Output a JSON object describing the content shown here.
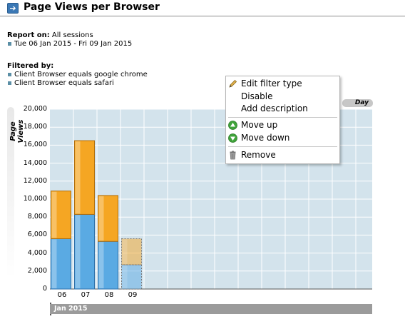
{
  "header": {
    "title": "Page Views per Browser",
    "collapse_icon": "arrow-right-icon"
  },
  "report": {
    "label": "Report on:",
    "value": "All sessions",
    "date_range": "Tue 06 Jan 2015 - Fri 09 Jan 2015"
  },
  "filters": {
    "label": "Filtered by:",
    "items": [
      "Client Browser equals google chrome",
      "Client Browser equals safari"
    ]
  },
  "context_menu": {
    "items": [
      {
        "label": "Edit filter type",
        "icon": "pencil-icon"
      },
      {
        "label": "Disable",
        "icon": ""
      },
      {
        "label": "Add description",
        "icon": ""
      },
      {
        "label": "Move up",
        "icon": "arrow-up-circle-icon"
      },
      {
        "label": "Move down",
        "icon": "arrow-down-circle-icon"
      },
      {
        "label": "Remove",
        "icon": "trash-icon"
      }
    ]
  },
  "chart_data": {
    "type": "bar",
    "stacked": true,
    "title": "",
    "ylabel": "Page Views",
    "xlabel": "",
    "ylim": [
      0,
      20000
    ],
    "yticks": [
      "0",
      "2,000",
      "4,000",
      "6,000",
      "8,000",
      "10,000",
      "12,000",
      "14,000",
      "16,000",
      "18,000",
      "20,000"
    ],
    "categories": [
      "06",
      "07",
      "08",
      "09"
    ],
    "partial_categories": [
      "09"
    ],
    "series": [
      {
        "color": "#5aaae3",
        "values": [
          5600,
          8300,
          5300,
          2700
        ]
      },
      {
        "color": "#f5a623",
        "values": [
          5300,
          8200,
          5100,
          2900
        ]
      }
    ],
    "period_label": "Jan 2015",
    "granularity_label": "Day",
    "grid": true,
    "colors": {
      "plot_bg": "#d3e3ec",
      "grid": "#ffffff"
    }
  }
}
